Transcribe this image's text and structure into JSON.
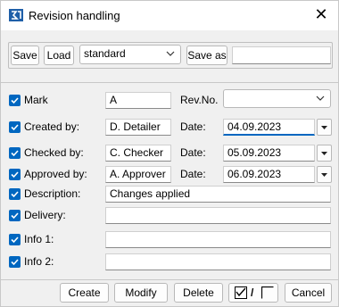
{
  "window": {
    "title": "Revision handling",
    "app_icon": "app-logo-icon",
    "close_icon": "close-icon"
  },
  "toolbar": {
    "save_label": "Save",
    "load_label": "Load",
    "profile_value": "standard",
    "save_as_label": "Save as",
    "save_as_value": ""
  },
  "form": {
    "mark": {
      "label": "Mark",
      "value": "A",
      "checked": true
    },
    "rev_no": {
      "label": "Rev.No.",
      "value": ""
    },
    "created_by": {
      "label": "Created by:",
      "value": "D. Detailer",
      "checked": true,
      "date_label": "Date:",
      "date_value": "04.09.2023"
    },
    "checked_by": {
      "label": "Checked by:",
      "value": "C. Checker",
      "checked": true,
      "date_label": "Date:",
      "date_value": "05.09.2023"
    },
    "approved_by": {
      "label": "Approved by:",
      "value": "A. Approver",
      "checked": true,
      "date_label": "Date:",
      "date_value": "06.09.2023"
    },
    "description": {
      "label": "Description:",
      "value": "Changes applied",
      "checked": true
    },
    "delivery": {
      "label": "Delivery:",
      "value": "",
      "checked": true
    },
    "info1": {
      "label": "Info 1:",
      "value": "",
      "checked": true
    },
    "info2": {
      "label": "Info 2:",
      "value": "",
      "checked": true
    }
  },
  "footer": {
    "create_label": "Create",
    "modify_label": "Modify",
    "delete_label": "Delete",
    "toggle_sep": "/",
    "cancel_label": "Cancel"
  },
  "colors": {
    "accent": "#0067c0",
    "background": "#f0f0f0"
  }
}
